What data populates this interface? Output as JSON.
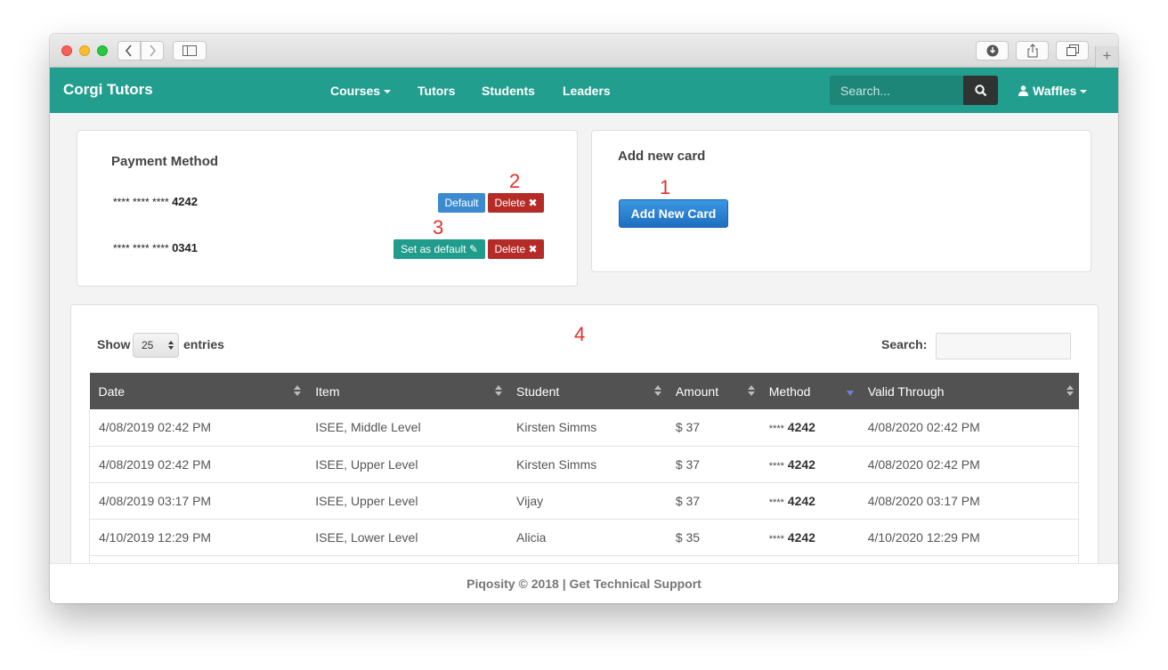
{
  "navbar": {
    "brand": "Corgi Tutors",
    "links": [
      "Courses",
      "Tutors",
      "Students",
      "Leaders"
    ],
    "search_placeholder": "Search...",
    "user": "Waffles",
    "color": "#229e8f"
  },
  "payment": {
    "title": "Payment Method",
    "cards": [
      {
        "masked": "**** **** ****",
        "last4": "4242",
        "status_label": "Default",
        "delete_label": "Delete"
      },
      {
        "masked": "**** **** ****",
        "last4": "0341",
        "status_label": "Set as default",
        "delete_label": "Delete"
      }
    ]
  },
  "add_card": {
    "title": "Add new card",
    "button_label": "Add New Card"
  },
  "annotations": [
    "1",
    "2",
    "3",
    "4"
  ],
  "datatable": {
    "show_label": "Show",
    "page_size": "25",
    "entries_label": "entries",
    "search_label": "Search:",
    "columns": [
      "Date",
      "Item",
      "Student",
      "Amount",
      "Method",
      "Valid Through"
    ],
    "rows": [
      {
        "date": "4/08/2019 02:42 PM",
        "item": "ISEE, Middle Level",
        "student": "Kirsten Simms",
        "amount": "$ 37",
        "method_stars": "****",
        "method_last4": "4242",
        "valid": "4/08/2020 02:42 PM"
      },
      {
        "date": "4/08/2019 02:42 PM",
        "item": "ISEE, Upper Level",
        "student": "Kirsten Simms",
        "amount": "$ 37",
        "method_stars": "****",
        "method_last4": "4242",
        "valid": "4/08/2020 02:42 PM"
      },
      {
        "date": "4/08/2019 03:17 PM",
        "item": "ISEE, Upper Level",
        "student": "Vijay",
        "amount": "$ 37",
        "method_stars": "****",
        "method_last4": "4242",
        "valid": "4/08/2020 03:17 PM"
      },
      {
        "date": "4/10/2019 12:29 PM",
        "item": "ISEE, Lower Level",
        "student": "Alicia",
        "amount": "$ 35",
        "method_stars": "****",
        "method_last4": "4242",
        "valid": "4/10/2020 12:29 PM"
      }
    ]
  },
  "footer": {
    "text": "Piqosity © 2018 | Get Technical Support"
  }
}
